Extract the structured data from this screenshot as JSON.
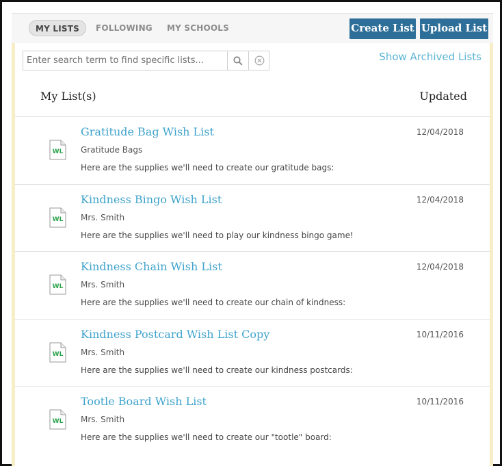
{
  "tabs": [
    {
      "label": "MY LISTS",
      "active": true
    },
    {
      "label": "FOLLOWING",
      "active": false
    },
    {
      "label": "MY SCHOOLS",
      "active": false
    }
  ],
  "buttons": {
    "create": "Create List",
    "upload": "Upload List"
  },
  "search": {
    "placeholder": "Enter search term to find specific lists...",
    "value": ""
  },
  "archived_link": "Show Archived Lists",
  "headers": {
    "lists": "My List(s)",
    "updated": "Updated"
  },
  "doc_icon_text": "WL",
  "colors": {
    "accent_button": "#2e6f99",
    "link": "#3fa3cc",
    "icon_green": "#2aa24a",
    "panel_border": "#f7eec8"
  },
  "lists": [
    {
      "title": "Gratitude Bag Wish List",
      "owner": "Gratitude Bags",
      "desc": "Here are the supplies we'll need to create our gratitude bags:",
      "date": "12/04/2018"
    },
    {
      "title": "Kindness Bingo Wish List",
      "owner": "Mrs. Smith",
      "desc": "Here are the supplies we'll need to play our kindness bingo game!",
      "date": "12/04/2018"
    },
    {
      "title": "Kindness Chain Wish List",
      "owner": "Mrs. Smith",
      "desc": "Here are the supplies we'll need to create our chain of kindness:",
      "date": "12/04/2018"
    },
    {
      "title": "Kindness Postcard Wish List Copy",
      "owner": "Mrs. Smith",
      "desc": "Here are the supplies we'll need to create our kindness postcards:",
      "date": "10/11/2016"
    },
    {
      "title": "Tootle Board Wish List",
      "owner": "Mrs. Smith",
      "desc": "Here are the supplies we'll need to create our \"tootle\" board:",
      "date": "10/11/2016"
    }
  ]
}
